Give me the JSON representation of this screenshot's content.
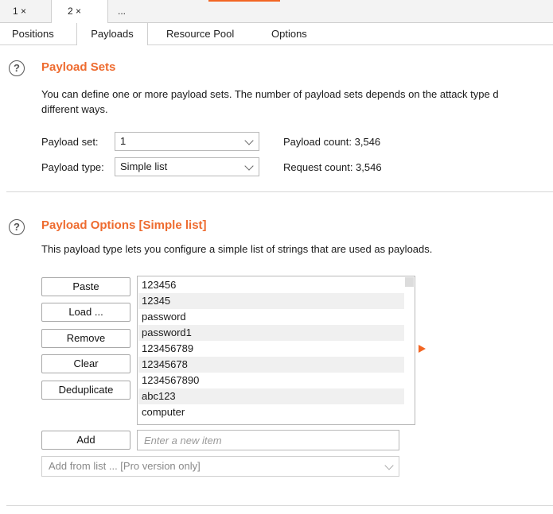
{
  "top_tabs": [
    {
      "label": "1 ×"
    },
    {
      "label": "2 ×"
    },
    {
      "label": "..."
    }
  ],
  "sub_tabs": [
    {
      "label": "Positions"
    },
    {
      "label": "Payloads"
    },
    {
      "label": "Resource Pool"
    },
    {
      "label": "Options"
    }
  ],
  "help_icon": "?",
  "payload_sets": {
    "title": "Payload Sets",
    "description_line1": "You can define one or more payload sets. The number of payload sets depends on the attack type d",
    "description_line2": "different ways.",
    "set_label": "Payload set:",
    "set_value": "1",
    "type_label": "Payload type:",
    "type_value": "Simple list",
    "payload_count": "Payload count: 3,546",
    "request_count": "Request count: 3,546"
  },
  "payload_options": {
    "title": "Payload Options [Simple list]",
    "description": "This payload type lets you configure a simple list of strings that are used as payloads.",
    "buttons": {
      "paste": "Paste",
      "load": "Load ...",
      "remove": "Remove",
      "clear": "Clear",
      "deduplicate": "Deduplicate",
      "add": "Add"
    },
    "list_items": [
      "123456",
      "12345",
      "password",
      "password1",
      "123456789",
      "12345678",
      "1234567890",
      "abc123",
      "computer"
    ],
    "new_item_placeholder": "Enter a new item",
    "add_from_list": "Add from list ... [Pro version only]"
  },
  "colors": {
    "accent": "#f26522",
    "section_title": "#ee6b2f"
  }
}
